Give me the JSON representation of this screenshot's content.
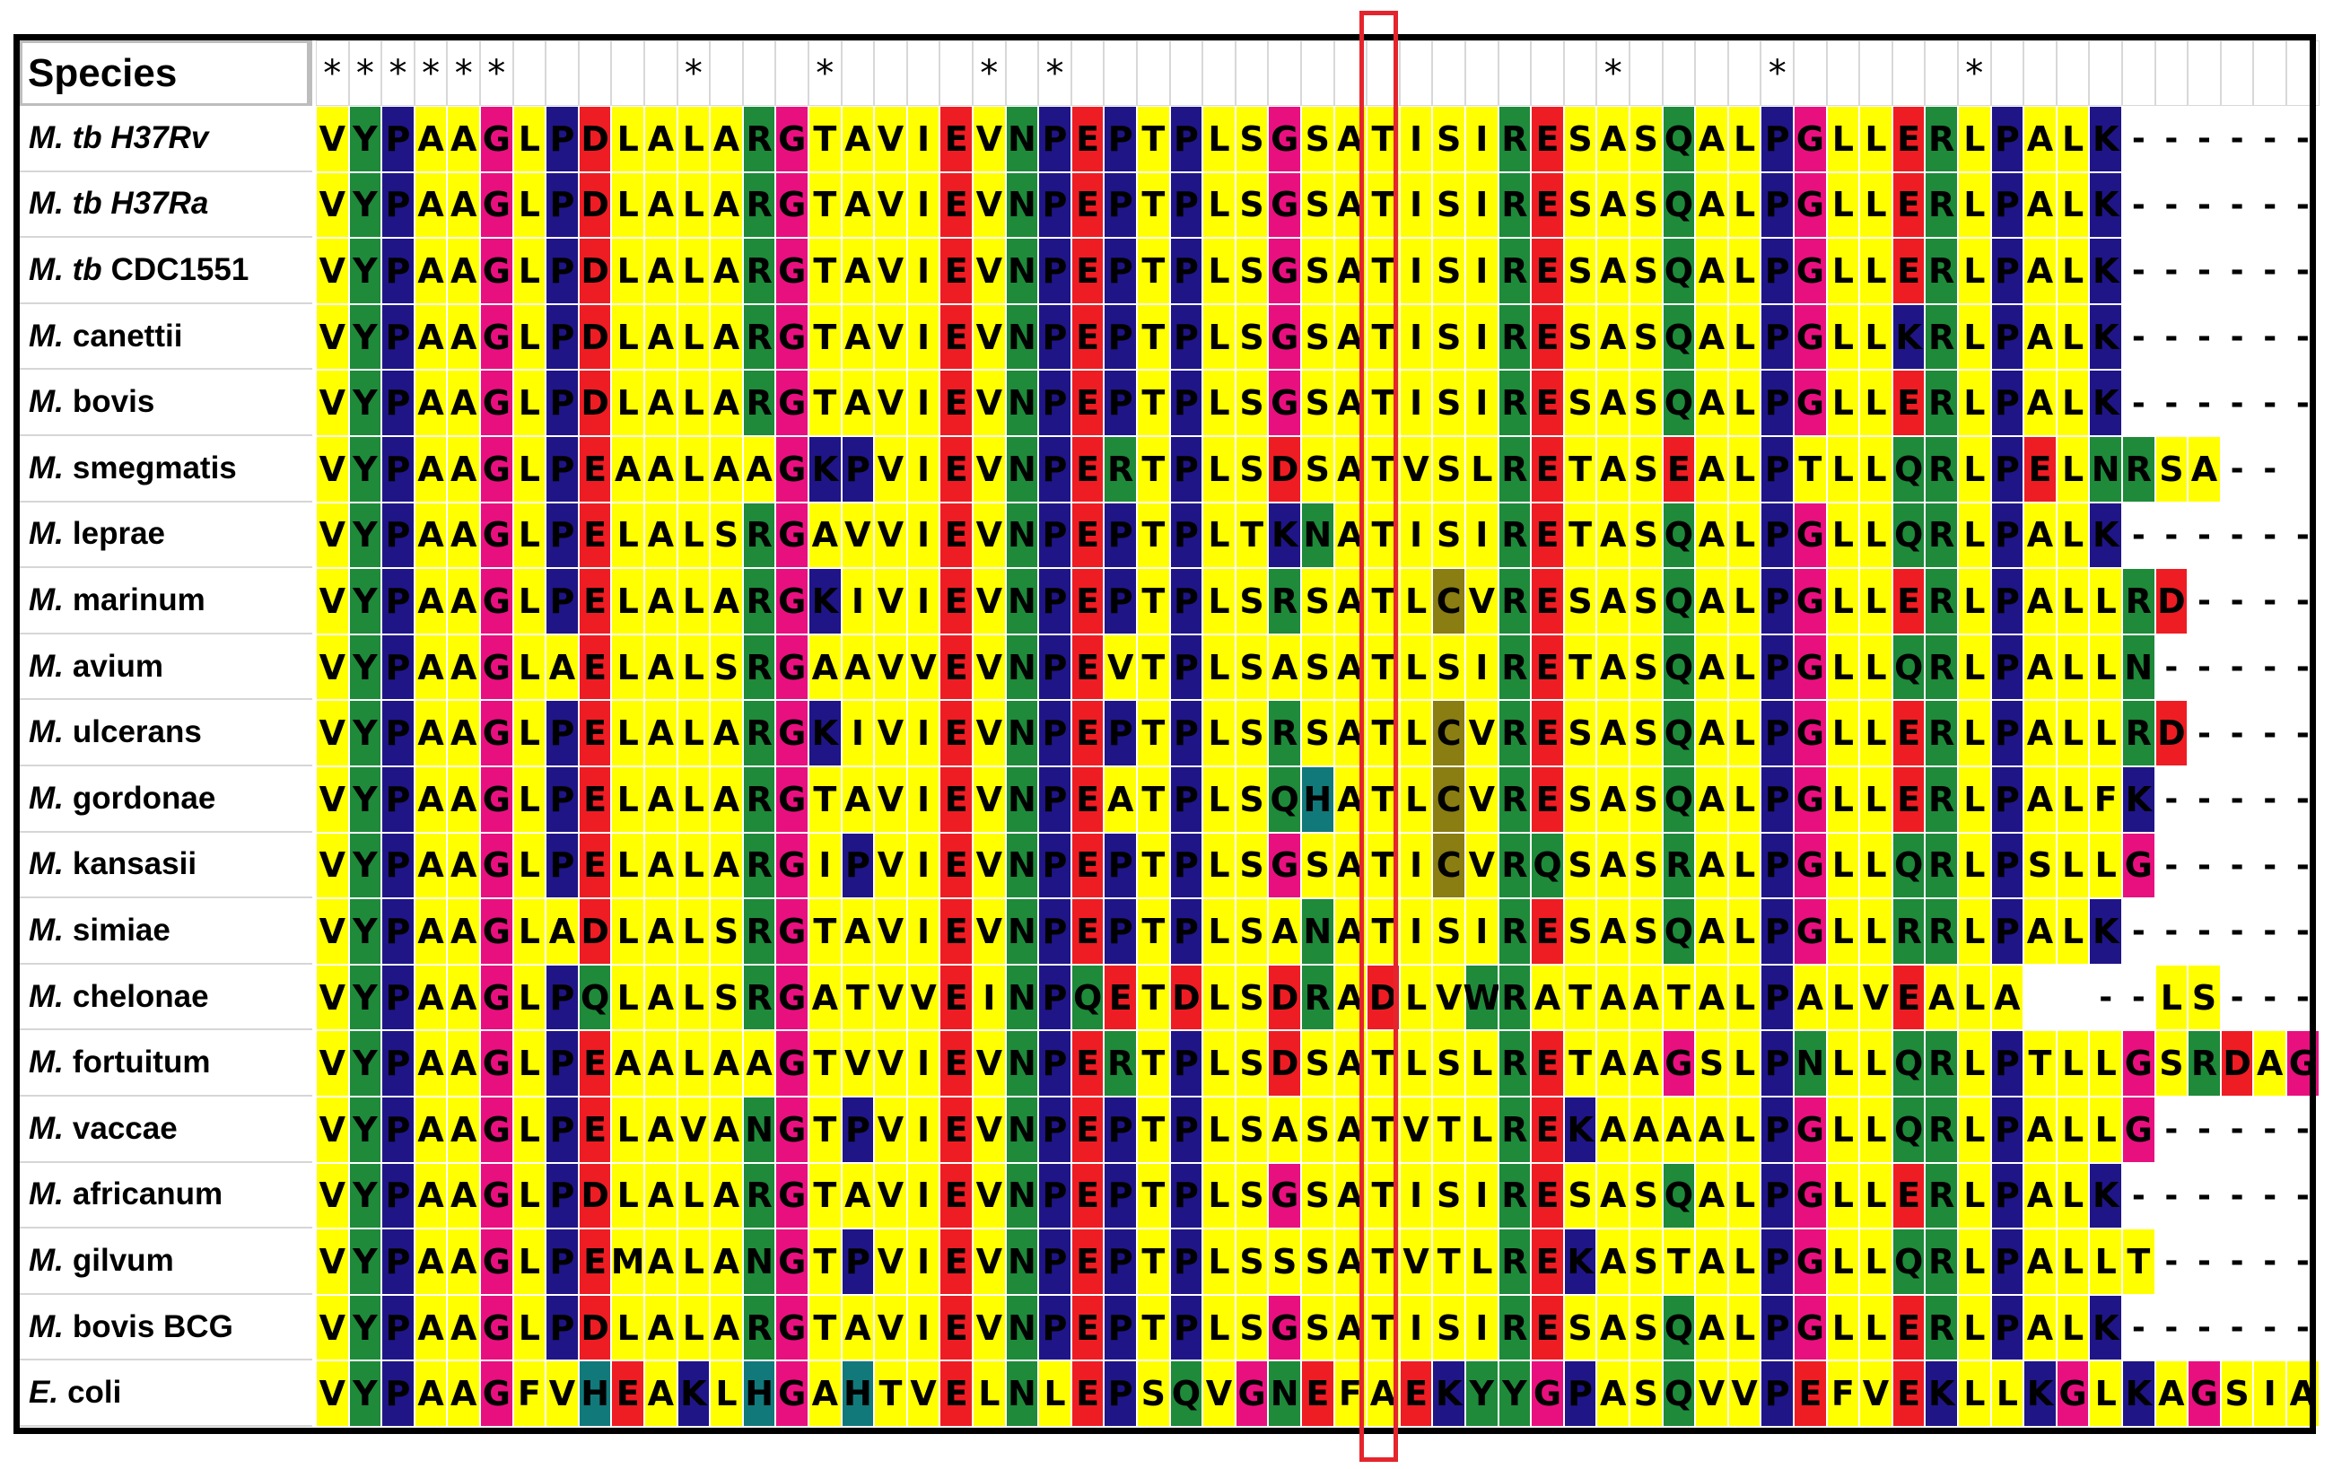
{
  "header_label": "Species",
  "conservation_columns": [
    1,
    2,
    3,
    4,
    5,
    6,
    12,
    16,
    21,
    23,
    40,
    45,
    51
  ],
  "highlight_column": 33,
  "species": [
    {
      "italic": "M. tb H37Rv",
      "rest": ""
    },
    {
      "italic": "M. tb H37Ra",
      "rest": ""
    },
    {
      "italic": "M. tb",
      "rest": "CDC1551"
    },
    {
      "italic": "M.",
      "rest": "canettii"
    },
    {
      "italic": "M.",
      "rest": "bovis"
    },
    {
      "italic": "M.",
      "rest": "smegmatis"
    },
    {
      "italic": "M.",
      "rest": "leprae"
    },
    {
      "italic": "M.",
      "rest": "marinum"
    },
    {
      "italic": "M.",
      "rest": "avium"
    },
    {
      "italic": "M.",
      "rest": "ulcerans"
    },
    {
      "italic": "M.",
      "rest": "gordonae"
    },
    {
      "italic": "M.",
      "rest": "kansasii"
    },
    {
      "italic": "M.",
      "rest": "simiae"
    },
    {
      "italic": "M.",
      "rest": "chelonae"
    },
    {
      "italic": "M.",
      "rest": "fortuitum"
    },
    {
      "italic": "M.",
      "rest": "vaccae"
    },
    {
      "italic": "M.",
      "rest": "africanum"
    },
    {
      "italic": "M.",
      "rest": "gilvum"
    },
    {
      "italic": "M.",
      "rest": "bovis BCG"
    },
    {
      "italic": "E.",
      "rest": "coli"
    }
  ],
  "sequences": [
    "VYPAAGLPDLALARGTAVIEVNPEPTPLSGSATISIRESASQALPGLLERLPALK------",
    "VYPAAGLPDLALARGTAVIEVNPEPTPLSGSATISIRESASQALPGLLERLPALK------",
    "VYPAAGLPDLALARGTAVIEVNPEPTPLSGSATISIRESASQALPGLLERLPALK------",
    "VYPAAGLPDLALARGTAVIEVNPEPTPLSGSATISIRESASQALPGLLKRLPALK------",
    "VYPAAGLPDLALARGTAVIEVNPEPTPLSGSATISIRESASQALPGLLERLPALK------",
    "VYPAAGLPEAALAAGKPVIEVNPERTPLSDSATVSLRETASEALPTLLQRLPELNRSA--",
    "VYPAAGLPELALSRGAVVIEVNPEPTPLTKNATISIRETASQALPGLLQRLPALK------",
    "VYPAAGLPELALARGKIVIEVNPEPTPLSRSATLCVRESASQALPGLLERLPALLRD-----",
    "VYPAAGLAELALSRGAAVVEVNPEVTPLSASATLSIRETASQALPGLLQRLPALLN------",
    "VYPAAGLPELALARGKIVIEVNPEPTPLSRSATLCVRESASQALPGLLERLPALLRD-----",
    "VYPAAGLPELALARGTAVIEVNPEATPLSQHATLCVRESASQALPGLLERLPALFK------",
    "VYPAAGLPELALARGIPVIEVNPEPTPLSGSATICVRQSASRALPGLLQRLPSLLG------",
    "VYPAAGLADLALSRGTAVIEVNPEPTPLSANATISIRESASQALPGLLRRLPALK------",
    "VYPAAGLPQLALSRGATVVEINPQETDLSDRADLVWRATAATALPALVEALA  --LS------",
    "VYPAAGLPEAALAAGTVVIEVNPERTPLSDSATLSLRETAAGSLPNLLQRLPTLLGSRDAG",
    "VYPAAGLPELAVANGTPVIEVNPEPTPLSASATVTLREKAAAALPGLLQRLPALLG------",
    "VYPAAGLPDLALARGTAVIEVNPEPTPLSGSATISIRESASQALPGLLERLPALK------",
    "VYPAAGLPEMALANGTPVIEVNPEPTPLSSSATVTLREKASTALPGLLQRLPALLT------",
    "VYPAAGLPDLALARGTAVIEVNPEPTPLSGSATISIRESASQALPGLLERLPALK------",
    "VYPAAGFVHEAKLHGAHTVELNLEPSQVGNEFAEKYYGPASQVVPEFVEKLLKGLKAGSIA"
  ],
  "colors": {
    "yellow": "#ffff00",
    "green": "#1e8a3a",
    "navy": "#1f1587",
    "magenta": "#e8107f",
    "red": "#ee1d23",
    "teal": "#12797a",
    "olive": "#8a7d12",
    "highlight": "#e4252d"
  }
}
